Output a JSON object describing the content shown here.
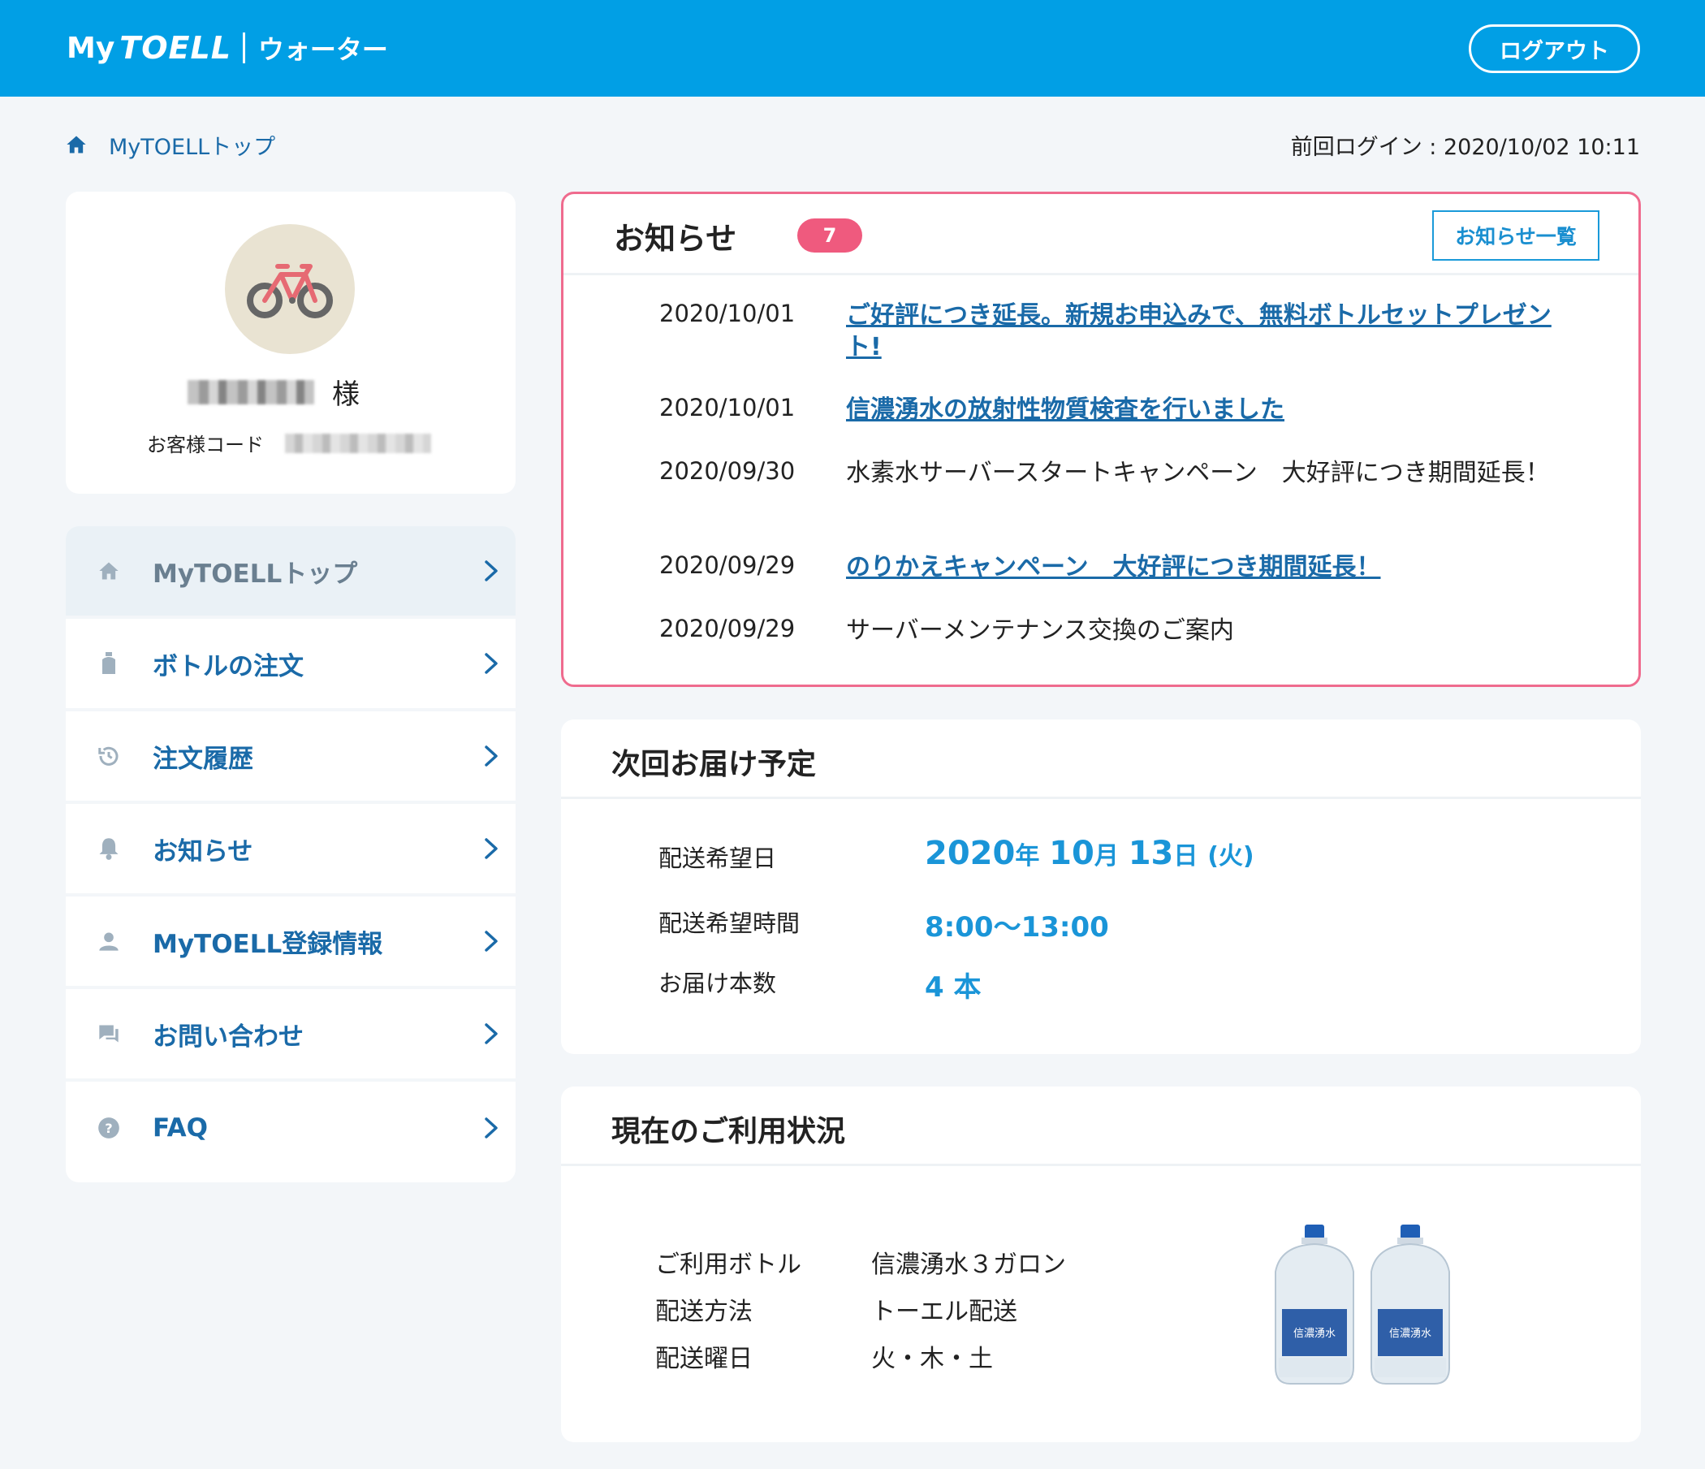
{
  "header": {
    "logo_my": "My",
    "logo_toell": "TOELL",
    "logo_sub": "ウォーター",
    "logout_label": "ログアウト"
  },
  "breadcrumb": {
    "home_label": "MyTOELLトップ"
  },
  "last_login": "前回ログイン : 2020/10/02 10:11",
  "profile": {
    "honorific": "様",
    "customer_code_label": "お客様コード"
  },
  "menu": {
    "items": [
      {
        "label": "MyTOELLトップ",
        "icon": "home-icon"
      },
      {
        "label": "ボトルの注文",
        "icon": "bottle-icon"
      },
      {
        "label": "注文履歴",
        "icon": "history-icon"
      },
      {
        "label": "お知らせ",
        "icon": "bell-icon"
      },
      {
        "label": "MyTOELL登録情報",
        "icon": "user-icon"
      },
      {
        "label": "お問い合わせ",
        "icon": "chat-icon"
      },
      {
        "label": "FAQ",
        "icon": "question-icon"
      }
    ]
  },
  "notices": {
    "title": "お知らせ",
    "count": "7",
    "all_button": "お知らせ一覧",
    "items": [
      {
        "date": "2020/10/01",
        "text": "ご好評につき延長。新規お申込みで、無料ボトルセットプレゼント!",
        "is_link": true
      },
      {
        "date": "2020/10/01",
        "text": "信濃湧水の放射性物質検査を行いました",
        "is_link": true
      },
      {
        "date": "2020/09/30",
        "text": "水素水サーバースタートキャンペーン　大好評につき期間延長！",
        "is_link": false
      },
      {
        "date": "2020/09/29",
        "text": "のりかえキャンペーン　大好評につき期間延長！",
        "is_link": true
      },
      {
        "date": "2020/09/29",
        "text": "サーバーメンテナンス交換のご案内",
        "is_link": false
      }
    ]
  },
  "delivery": {
    "title": "次回お届け予定",
    "date_label": "配送希望日",
    "date_year": "2020",
    "date_year_unit": "年",
    "date_month": "10",
    "date_month_unit": "月",
    "date_day": "13",
    "date_day_unit": "日",
    "date_weekday": "(火)",
    "time_label": "配送希望時間",
    "time_value": "8:00〜13:00",
    "qty_label": "お届け本数",
    "qty_value": "4 本"
  },
  "usage": {
    "title": "現在のご利用状況",
    "rows": [
      {
        "label": "ご利用ボトル",
        "value": "信濃湧水３ガロン"
      },
      {
        "label": "配送方法",
        "value": "トーエル配送"
      },
      {
        "label": "配送曜日",
        "value": "火・木・土"
      }
    ],
    "bottle_label": "信濃湧水"
  },
  "colors": {
    "header_bg": "#019fe5",
    "accent_link": "#1a6aa8",
    "notice_border": "#ef6b8e",
    "badge": "#ef5a7e",
    "delivery_value": "#1a95d8"
  }
}
